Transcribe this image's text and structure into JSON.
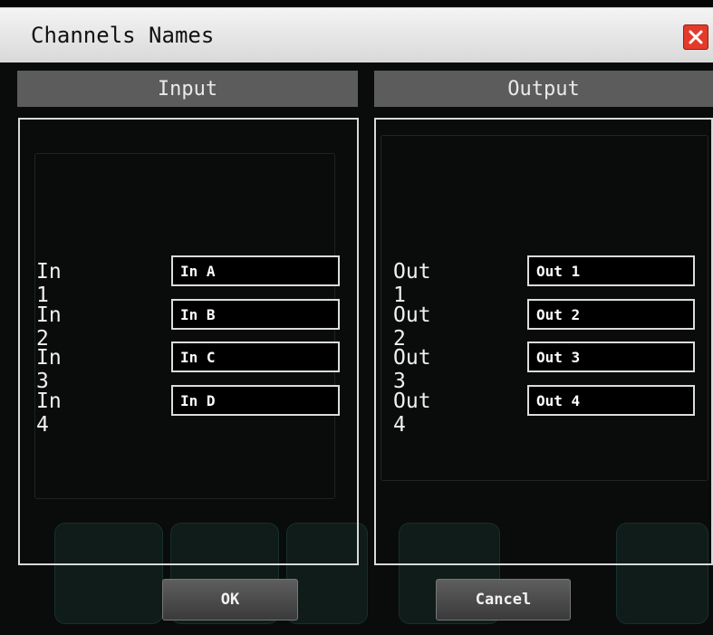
{
  "dialog": {
    "title": "Channels Names",
    "close_icon": "close-icon"
  },
  "input_panel": {
    "header": "Input",
    "rows": [
      {
        "label": "In 1",
        "value": "In A"
      },
      {
        "label": "In 2",
        "value": "In B"
      },
      {
        "label": "In 3",
        "value": "In C"
      },
      {
        "label": "In 4",
        "value": "In D"
      }
    ]
  },
  "output_panel": {
    "header": "Output",
    "rows": [
      {
        "label": "Out 1",
        "value": "Out 1"
      },
      {
        "label": "Out 2",
        "value": "Out 2"
      },
      {
        "label": "Out 3",
        "value": "Out 3"
      },
      {
        "label": "Out 4",
        "value": "Out 4"
      }
    ]
  },
  "buttons": {
    "ok": "OK",
    "cancel": "Cancel"
  },
  "colors": {
    "close_button": "#e43a2a",
    "panel_header": "#5c5c5c",
    "dialog_background": "#0a0b0b"
  }
}
